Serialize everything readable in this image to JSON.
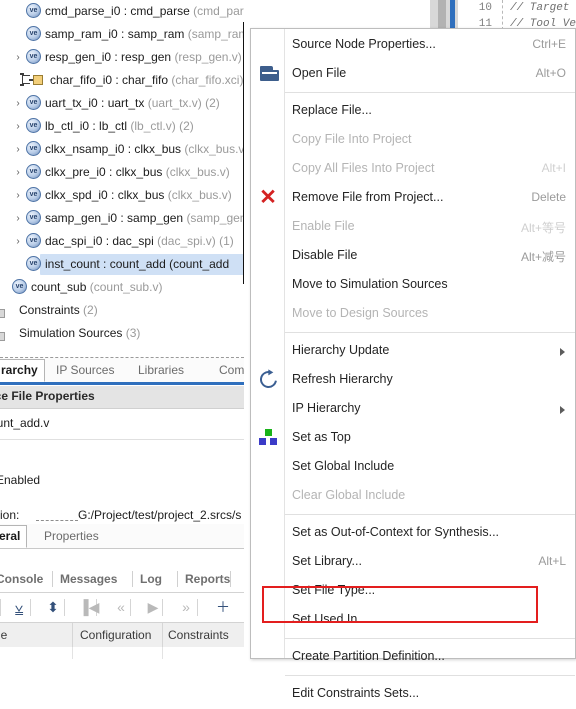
{
  "app": "vivado-sources-panel",
  "hierarchy_tree": {
    "rows": [
      {
        "indent": 26,
        "twisty": "",
        "icon": "verilog-module-icon",
        "name": "cmd_parse_i0 : cmd_parse",
        "file": "(cmd_parse.v)",
        "count": "",
        "selected": false
      },
      {
        "indent": 26,
        "twisty": "",
        "icon": "verilog-module-icon",
        "name": "samp_ram_i0 : samp_ram",
        "file": "(samp_ram.v)",
        "count": "",
        "selected": false
      },
      {
        "indent": 26,
        "twisty": ">",
        "icon": "verilog-module-icon",
        "name": "resp_gen_i0 : resp_gen",
        "file": "(resp_gen.v)",
        "count": "",
        "selected": false
      },
      {
        "indent": 26,
        "twisty": "",
        "icon": "ip-core-icon",
        "name": "char_fifo_i0 : char_fifo",
        "file": "(char_fifo.xci)",
        "count": "",
        "selected": false
      },
      {
        "indent": 26,
        "twisty": ">",
        "icon": "verilog-module-icon",
        "name": "uart_tx_i0 : uart_tx",
        "file": "(uart_tx.v)",
        "count": "(2)",
        "selected": false
      },
      {
        "indent": 26,
        "twisty": ">",
        "icon": "verilog-module-icon",
        "name": "lb_ctl_i0 : lb_ctl",
        "file": "(lb_ctl.v)",
        "count": "(2)",
        "selected": false
      },
      {
        "indent": 26,
        "twisty": ">",
        "icon": "verilog-module-icon",
        "name": "clkx_nsamp_i0 : clkx_bus",
        "file": "(clkx_bus.v)",
        "count": "",
        "selected": false
      },
      {
        "indent": 26,
        "twisty": ">",
        "icon": "verilog-module-icon",
        "name": "clkx_pre_i0 : clkx_bus",
        "file": "(clkx_bus.v)",
        "count": "",
        "selected": false
      },
      {
        "indent": 26,
        "twisty": ">",
        "icon": "verilog-module-icon",
        "name": "clkx_spd_i0 : clkx_bus",
        "file": "(clkx_bus.v)",
        "count": "",
        "selected": false
      },
      {
        "indent": 26,
        "twisty": ">",
        "icon": "verilog-module-icon",
        "name": "samp_gen_i0 : samp_gen",
        "file": "(samp_gen.v)",
        "count": "",
        "selected": false
      },
      {
        "indent": 26,
        "twisty": ">",
        "icon": "verilog-module-icon",
        "name": "dac_spi_i0 : dac_spi",
        "file": "(dac_spi.v)",
        "count": "(1)",
        "selected": false
      },
      {
        "indent": 26,
        "twisty": "",
        "icon": "verilog-module-icon",
        "name": "inst_count : count_add (count_add",
        "file": "",
        "count": "",
        "selected": true
      },
      {
        "indent": 12,
        "twisty": "",
        "icon": "verilog-module-icon",
        "name": "count_sub",
        "file": "(count_sub.v)",
        "count": "",
        "selected": false
      },
      {
        "indent": 0,
        "twisty": "",
        "icon": "constraints-folder-icon",
        "name": "Constraints",
        "file": "(2)",
        "count": "",
        "selected": false
      },
      {
        "indent": 0,
        "twisty": "",
        "icon": "constraints-folder-icon",
        "name": "Simulation Sources",
        "file": "(3)",
        "count": "",
        "selected": false
      }
    ]
  },
  "sources_tabs": {
    "items": [
      {
        "label": "rarchy",
        "active": true
      },
      {
        "label": "IP Sources",
        "active": false
      },
      {
        "label": "Libraries",
        "active": false
      },
      {
        "label": "Comp",
        "active": false
      }
    ]
  },
  "source_file_properties": {
    "header": "rce File Properties",
    "file_name": "ount_add.v",
    "enabled_label": "Enabled",
    "location_key": "cation:",
    "location_value": "G:/Project/test/project_2.srcs/s"
  },
  "properties_tabs": {
    "items": [
      {
        "label": "eral",
        "active": true
      },
      {
        "label": "Properties",
        "active": false
      }
    ]
  },
  "console_tabs": {
    "items": [
      {
        "label": "Console",
        "active": false
      },
      {
        "label": "Messages",
        "active": false
      },
      {
        "label": "Log",
        "active": false
      },
      {
        "label": "Reports",
        "active": false
      }
    ]
  },
  "console_toolbar": {
    "buttons": [
      {
        "name": "collapse-all-icon",
        "glyph": "⩣",
        "enabled": true
      },
      {
        "name": "expand-collapse-icon",
        "glyph": "⬍",
        "enabled": true
      },
      {
        "name": "first-icon",
        "glyph": "▐◀",
        "enabled": false
      },
      {
        "name": "previous-icon",
        "glyph": "«",
        "enabled": false
      },
      {
        "name": "play-icon",
        "glyph": "▶",
        "enabled": false
      },
      {
        "name": "next-icon",
        "glyph": "»",
        "enabled": false
      },
      {
        "name": "add-icon",
        "glyph": "＋",
        "enabled": true
      }
    ]
  },
  "results_grid": {
    "columns": [
      "ne",
      "Configuration",
      "Constraints"
    ]
  },
  "editor": {
    "lines": [
      {
        "number": "10",
        "text": "// Target ."
      },
      {
        "number": "11",
        "text": "// Tool Ve"
      }
    ]
  },
  "context_menu": {
    "items": [
      {
        "label": "Source Node Properties...",
        "shortcut": "Ctrl+E",
        "enabled": true,
        "icon": "",
        "submenu": false,
        "separator_after": false
      },
      {
        "label": "Open File",
        "shortcut": "Alt+O",
        "enabled": true,
        "icon": "open-folder-icon",
        "submenu": false,
        "separator_after": true
      },
      {
        "label": "Replace File...",
        "shortcut": "",
        "enabled": true,
        "icon": "",
        "submenu": false,
        "separator_after": false
      },
      {
        "label": "Copy File Into Project",
        "shortcut": "",
        "enabled": false,
        "icon": "",
        "submenu": false,
        "separator_after": false
      },
      {
        "label": "Copy All Files Into Project",
        "shortcut": "Alt+I",
        "enabled": false,
        "icon": "",
        "submenu": false,
        "separator_after": false
      },
      {
        "label": "Remove File from Project...",
        "shortcut": "Delete",
        "enabled": true,
        "icon": "remove-x-icon",
        "submenu": false,
        "separator_after": false
      },
      {
        "label": "Enable File",
        "shortcut": "Alt+等号",
        "enabled": false,
        "icon": "",
        "submenu": false,
        "separator_after": false
      },
      {
        "label": "Disable File",
        "shortcut": "Alt+减号",
        "enabled": true,
        "icon": "",
        "submenu": false,
        "separator_after": false
      },
      {
        "label": "Move to Simulation Sources",
        "shortcut": "",
        "enabled": true,
        "icon": "",
        "submenu": false,
        "separator_after": false
      },
      {
        "label": "Move to Design Sources",
        "shortcut": "",
        "enabled": false,
        "icon": "",
        "submenu": false,
        "separator_after": true
      },
      {
        "label": "Hierarchy Update",
        "shortcut": "",
        "enabled": true,
        "icon": "",
        "submenu": true,
        "separator_after": false
      },
      {
        "label": "Refresh Hierarchy",
        "shortcut": "",
        "enabled": true,
        "icon": "refresh-icon",
        "submenu": false,
        "separator_after": false
      },
      {
        "label": "IP Hierarchy",
        "shortcut": "",
        "enabled": true,
        "icon": "",
        "submenu": true,
        "separator_after": false
      },
      {
        "label": "Set as Top",
        "shortcut": "",
        "enabled": true,
        "icon": "set-as-top-icon",
        "submenu": false,
        "separator_after": false
      },
      {
        "label": "Set Global Include",
        "shortcut": "",
        "enabled": true,
        "icon": "",
        "submenu": false,
        "separator_after": false
      },
      {
        "label": "Clear Global Include",
        "shortcut": "",
        "enabled": false,
        "icon": "",
        "submenu": false,
        "separator_after": true
      },
      {
        "label": "Set as Out-of-Context for Synthesis...",
        "shortcut": "",
        "enabled": true,
        "icon": "",
        "submenu": false,
        "separator_after": false
      },
      {
        "label": "Set Library...",
        "shortcut": "Alt+L",
        "enabled": true,
        "icon": "",
        "submenu": false,
        "separator_after": false
      },
      {
        "label": "Set File Type...",
        "shortcut": "",
        "enabled": true,
        "icon": "",
        "submenu": false,
        "separator_after": false
      },
      {
        "label": "Set Used In...",
        "shortcut": "",
        "enabled": true,
        "icon": "",
        "submenu": false,
        "separator_after": true
      },
      {
        "label": "Create Partition Definition...",
        "shortcut": "",
        "enabled": true,
        "icon": "",
        "submenu": false,
        "separator_after": true
      },
      {
        "label": "Edit Constraints Sets...",
        "shortcut": "",
        "enabled": true,
        "icon": "",
        "submenu": false,
        "separator_after": false
      }
    ],
    "highlight_index": 20,
    "highlight_color": "#e31e1e"
  }
}
